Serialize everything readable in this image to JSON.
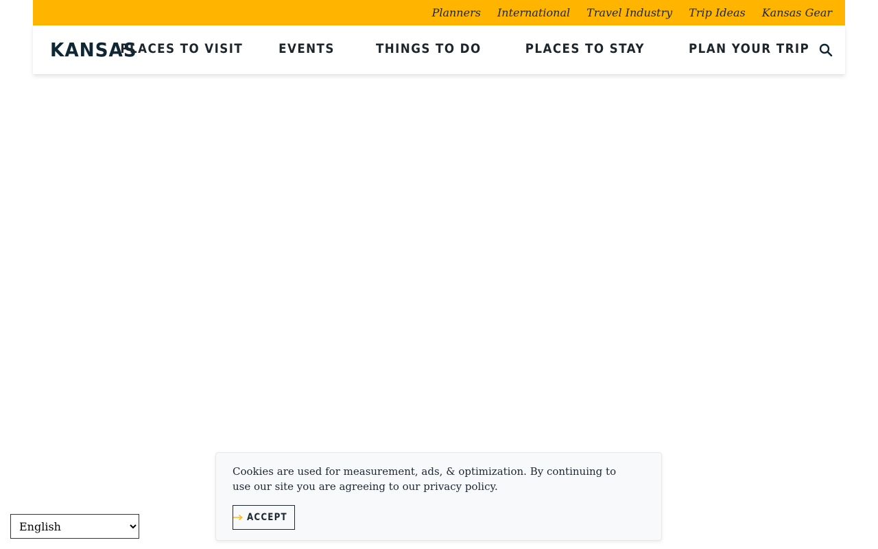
{
  "utility_nav": {
    "links": [
      "Planners",
      "International",
      "Travel Industry",
      "Trip Ideas",
      "Kansas Gear"
    ]
  },
  "header": {
    "logo": "KANSAS",
    "nav": [
      "PLACES TO VISIT",
      "EVENTS",
      "THINGS TO DO",
      "PLACES TO STAY",
      "PLAN YOUR TRIP"
    ],
    "search_icon": "search-icon"
  },
  "cookie_banner": {
    "message": "Cookies are used for measurement, ads, & optimization. By continuing to use our site you are agreeing to our privacy policy.",
    "accept_label": "ACCEPT",
    "accept_icon": "arrow-right-icon"
  },
  "language_select": {
    "selected": "English"
  },
  "colors": {
    "utility_bar": "#FFB400",
    "text_dark": "#1b2733",
    "accent_arrow": "#FFB400"
  }
}
